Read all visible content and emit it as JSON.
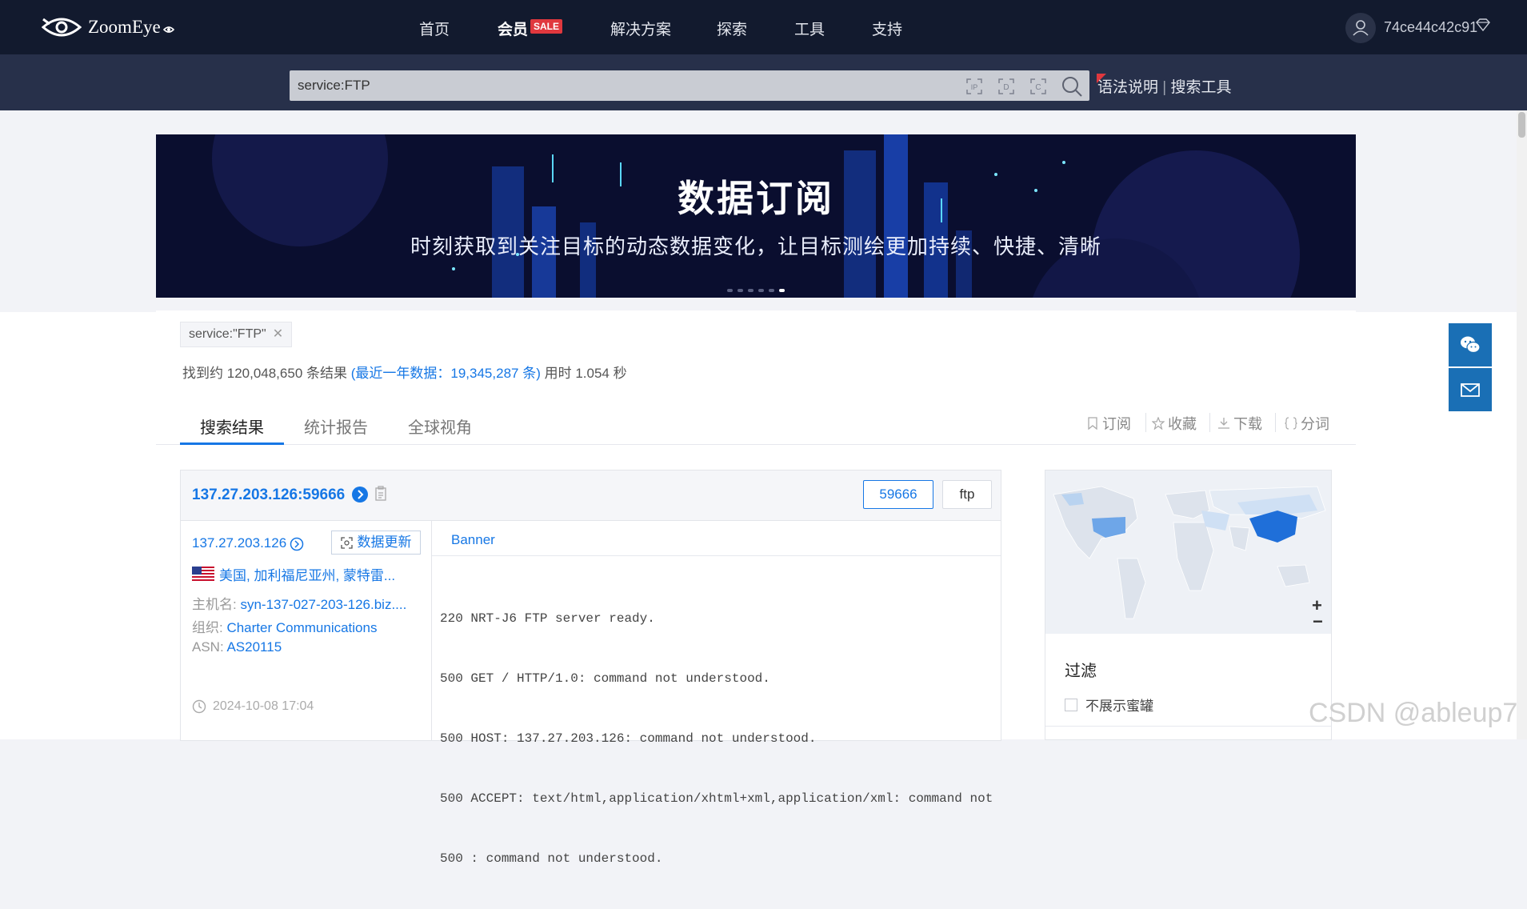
{
  "brand": {
    "name": "ZoomEye"
  },
  "nav": {
    "items": [
      "首页",
      "会员",
      "解决方案",
      "探索",
      "工具",
      "支持"
    ],
    "sale_badge": "SALE"
  },
  "user": {
    "name": "74ce44c42c91"
  },
  "search": {
    "query": "service:FTP",
    "syntax_link": "语法说明",
    "tools_link": "搜索工具",
    "syntax_sep": "|"
  },
  "banner": {
    "title": "数据订阅",
    "subtitle": "时刻获取到关注目标的动态数据变化，让目标测绘更加持续、快捷、清晰",
    "dot_count": 6,
    "active_dot": 5
  },
  "query_tag": {
    "label": "service:\"FTP\""
  },
  "results": {
    "prefix": "找到约 ",
    "count": "120,048,650",
    "mid": " 条结果 ",
    "recent": "(最近一年数据：19,345,287 条)",
    "time_label": " 用时 1.054 秒"
  },
  "tabs": [
    "搜索结果",
    "统计报告",
    "全球视角"
  ],
  "active_tab": 0,
  "actions": {
    "subscribe": "订阅",
    "favorite": "收藏",
    "download": "下载",
    "tokenize": "分词"
  },
  "card": {
    "title": "137.27.203.126:59666",
    "port": "59666",
    "service": "ftp",
    "ip": "137.27.203.126",
    "update_label": "数据更新",
    "location": "美国, 加利福尼亚州, 蒙特雷...",
    "hostname_label": "主机名: ",
    "hostname": "syn-137-027-203-126.biz....",
    "org_label": "组织: ",
    "org": "Charter Communications",
    "asn_label": "ASN: ",
    "asn": "AS20115",
    "timestamp": "2024-10-08 17:04",
    "banner_tab": "Banner",
    "banner_lines": [
      "220 NRT-J6 FTP server ready.",
      "500 GET / HTTP/1.0: command not understood.",
      "500 HOST: 137.27.203.126: command not understood.",
      "500 ACCEPT: text/html,application/xhtml+xml,application/xml: command not",
      "500 : command not understood."
    ]
  },
  "map": {
    "zoom_in": "+",
    "zoom_out": "−"
  },
  "filter": {
    "title": "过滤",
    "option": "不展示蜜罐"
  },
  "watermark": "CSDN @ableup7",
  "colors": {
    "accent": "#1677e5",
    "nav_bg": "#121a2e",
    "search_bg": "#27304a",
    "float_btn": "#1a6fb5"
  }
}
